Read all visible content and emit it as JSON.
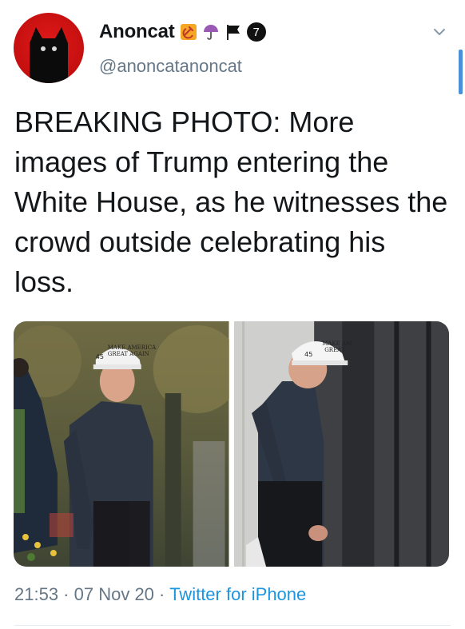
{
  "tweet": {
    "display_name": "Anoncat",
    "handle": "@anoncatanoncat",
    "badges": [
      "hammer-sickle-icon",
      "umbrella-icon",
      "black-flag-icon",
      "number-seven-icon"
    ],
    "badge_number": "7",
    "text": "BREAKING PHOTO: More images of Trump entering the White House, as he witnesses the crowd outside celebrating his loss.",
    "time": "21:53",
    "separator": " · ",
    "date": "07 Nov 20",
    "source": "Twitter for iPhone",
    "photos": [
      {
        "name": "photo-trump-walking",
        "cap_text_line1": "MAKE AMERICA",
        "cap_text_line2": "GREAT AGAIN",
        "cap_number": "45"
      },
      {
        "name": "photo-trump-entering",
        "cap_text_line1": "MAKE AM",
        "cap_text_line2": "GREAT",
        "cap_number": "45"
      }
    ]
  },
  "colors": {
    "accent": "#1b95e0",
    "secondary_text": "#657786",
    "avatar_bg": "#c50f0f"
  }
}
